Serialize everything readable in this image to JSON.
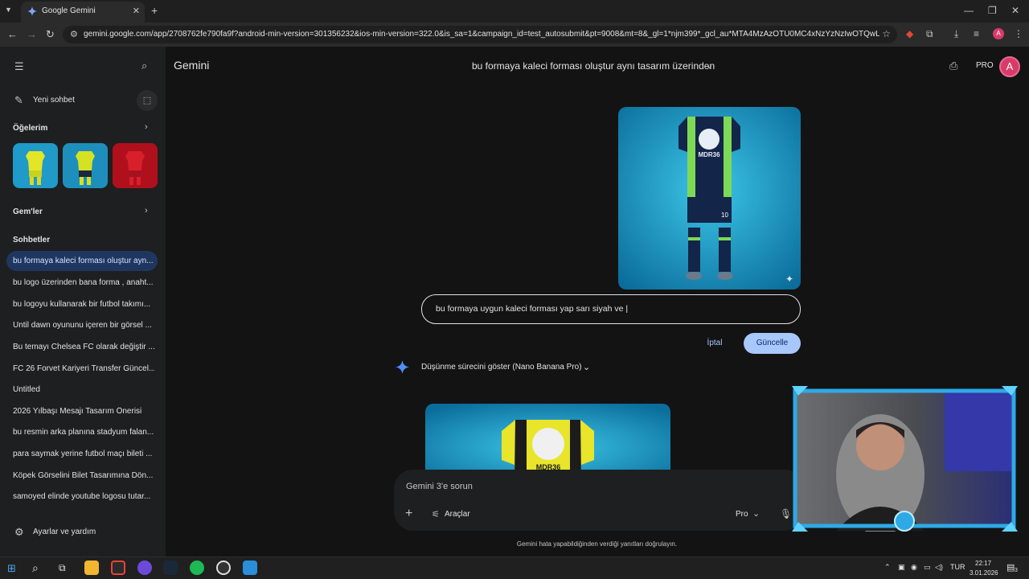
{
  "browser": {
    "tab_title": "Google Gemini",
    "url": "gemini.google.com/app/2708762fe790fa9f?android-min-version=301356232&ios-min-version=322.0&is_sa=1&campaign_id=test_autosubmit&pt=9008&mt=8&_gl=1*njm399*_gcl_au*MTA4MzAzOTU0MC4xNzYzNzIwOTQwLjE3MDM5M..."
  },
  "sidebar": {
    "new_chat": "Yeni sohbet",
    "items_header": "Öğelerim",
    "gems_header": "Gem'ler",
    "chats_header": "Sohbetler",
    "chats": [
      "bu formaya kaleci forması oluştur ayn...",
      "bu logo üzerinden bana forma , anaht...",
      "bu logoyu kullanarak bir futbol takımı...",
      "Until dawn oyununu içeren bir görsel ...",
      "Bu temayı Chelsea FC olarak değiştir ...",
      "FC 26 Forvet Kariyeri Transfer Güncel...",
      "Untitled",
      "2026 Yılbaşı Mesajı Tasarım Önerisi",
      "bu resmin arka planına stadyum falan...",
      "para saymak yerine futbol maçı bileti ...",
      "Köpek Görselini Bilet Tasarımına Dön...",
      "samoyed elinde youtube logosu tutar..."
    ],
    "settings": "Ayarlar ve yardım"
  },
  "header": {
    "brand": "Gemini",
    "conversation_title": "bu formaya kaleci forması oluştur aynı tasarım üzerinden",
    "plan": "PRO",
    "avatar_letter": "A"
  },
  "conversation": {
    "edit_text": "bu formaya uygun kaleci forması yap sarı siyah ve |",
    "cancel_label": "İptal",
    "update_label": "Güncelle",
    "thinking_label": "Düşünme sürecini göster (Nano Banana Pro)",
    "jersey_text": "MDR36",
    "jersey_number": "10"
  },
  "composer": {
    "placeholder": "Gemini 3'e sorun",
    "tools_label": "Araçlar",
    "model_label": "Pro",
    "disclaimer": "Gemini hata yapabildiğinden verdiği yanıtları doğrulayın."
  },
  "taskbar": {
    "lang": "TUR",
    "time": "22:17",
    "date": "3.01.2026",
    "notif": "3"
  },
  "colors": {
    "accent": "#a8c7fa",
    "active_chat": "#1f3760",
    "avatar": "#d93b68"
  }
}
